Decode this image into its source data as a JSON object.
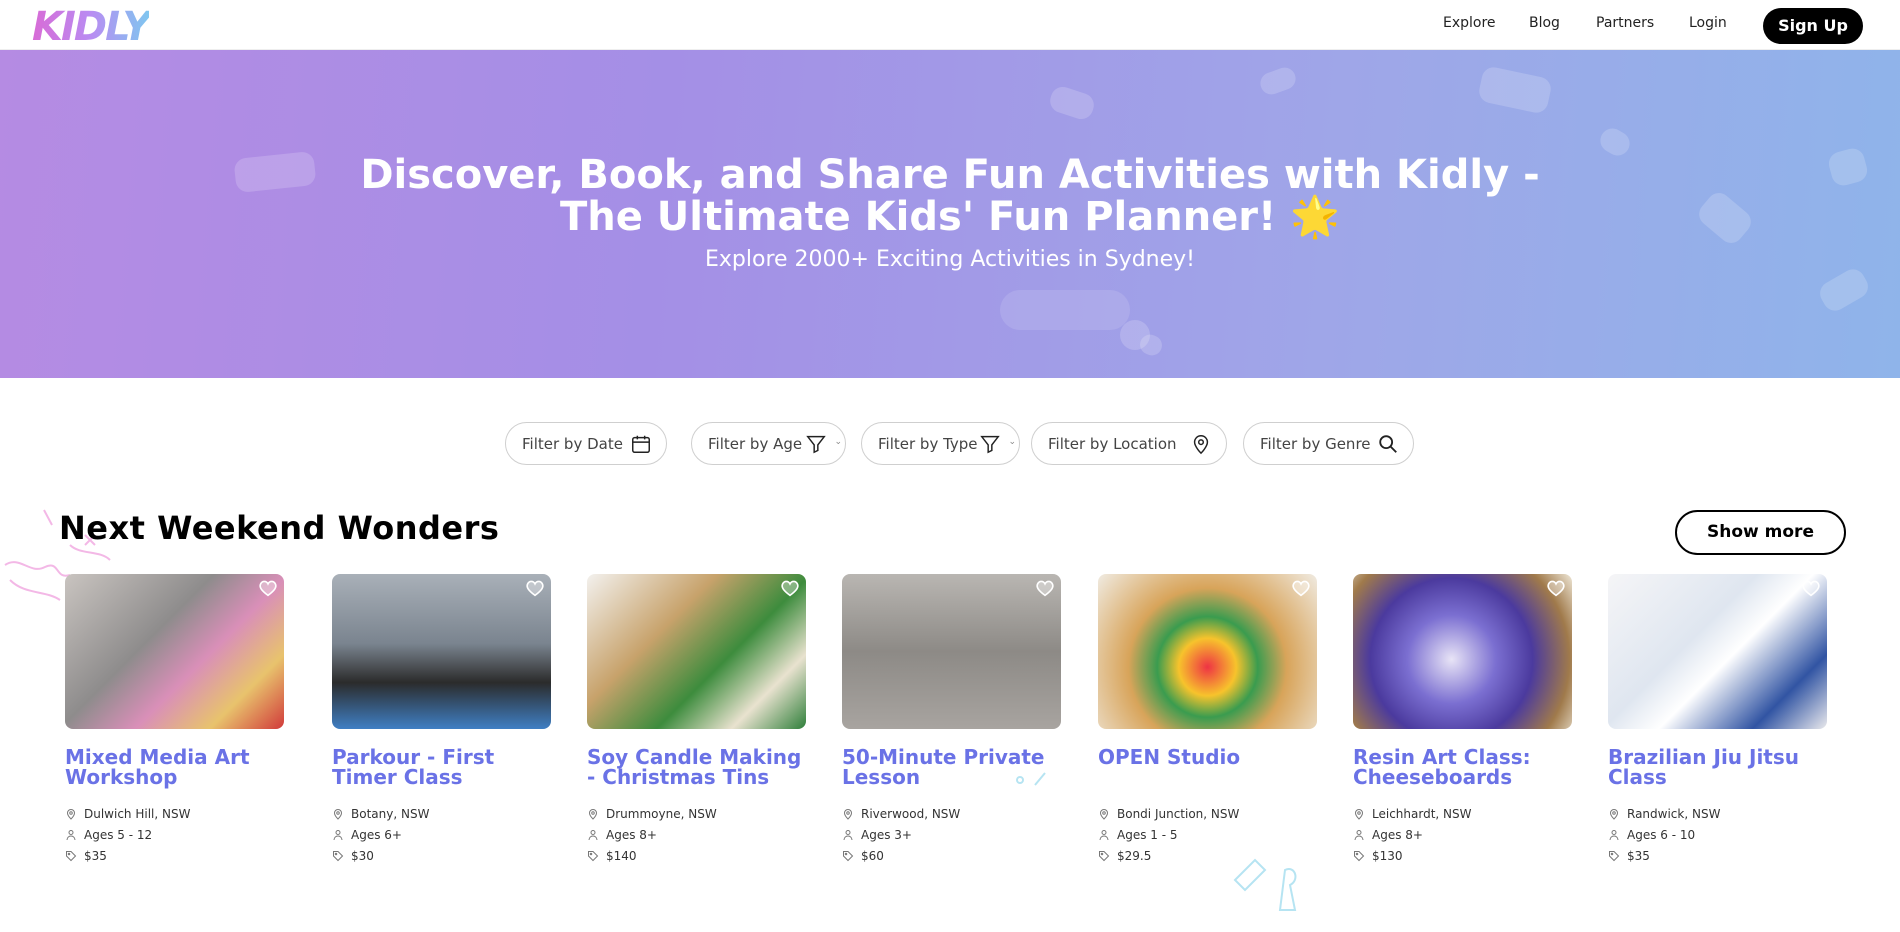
{
  "nav": {
    "logo": "KIDLY",
    "links": [
      "Explore",
      "Blog",
      "Partners",
      "Login"
    ],
    "signup": "Sign Up"
  },
  "hero": {
    "title_line1": "Discover, Book, and Share Fun Activities with Kidly -",
    "title_line2": "The Ultimate Kids' Fun Planner! 🌟",
    "subtitle": "Explore 2000+ Exciting Activities in Sydney!"
  },
  "filters": [
    {
      "label": "Filter by Date",
      "icon": "calendar-icon"
    },
    {
      "label": "Filter by Age",
      "icon": "filter-icon"
    },
    {
      "label": "Filter by Type",
      "icon": "filter-icon"
    },
    {
      "label": "Filter by Location",
      "icon": "location-pin-icon"
    },
    {
      "label": "Filter by Genre",
      "icon": "search-icon"
    }
  ],
  "section": {
    "title": "Next Weekend Wonders",
    "show_more": "Show more"
  },
  "cards": [
    {
      "title": "Mixed Media Art Workshop",
      "location": "Dulwich Hill, NSW",
      "ages": "Ages 5 - 12",
      "price": "$35"
    },
    {
      "title": "Parkour - First Timer Class",
      "location": "Botany, NSW",
      "ages": "Ages 6+",
      "price": "$30"
    },
    {
      "title": "Soy Candle Making - Christmas Tins",
      "location": "Drummoyne, NSW",
      "ages": "Ages 8+",
      "price": "$140"
    },
    {
      "title": "50-Minute Private Lesson",
      "location": "Riverwood, NSW",
      "ages": "Ages 3+",
      "price": "$60"
    },
    {
      "title": "OPEN Studio",
      "location": "Bondi Junction, NSW",
      "ages": "Ages 1 - 5",
      "price": "$29.5"
    },
    {
      "title": "Resin Art Class: Cheeseboards",
      "location": "Leichhardt, NSW",
      "ages": "Ages 8+",
      "price": "$130"
    },
    {
      "title": "Brazilian Jiu Jitsu Class",
      "location": "Randwick, NSW",
      "ages": "Ages 6 - 10",
      "price": "$35"
    }
  ],
  "colors": {
    "accent": "#6a72e6",
    "hero_start": "#b58be3",
    "hero_end": "#8fb4ea"
  }
}
